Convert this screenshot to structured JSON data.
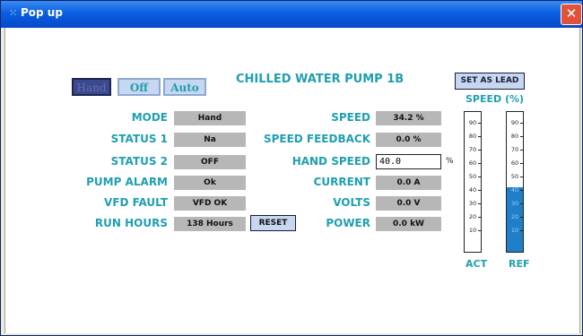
{
  "window": {
    "title": "Pop up"
  },
  "mode_buttons": {
    "hand": "Hand",
    "off": "Off",
    "auto": "Auto"
  },
  "pump_title": "CHILLED WATER PUMP 1B",
  "set_as_lead": "SET AS LEAD",
  "speed_pct_label": "SPEED (%)",
  "left_rows": [
    {
      "label": "MODE",
      "value": "Hand"
    },
    {
      "label": "STATUS 1",
      "value": "Na"
    },
    {
      "label": "STATUS 2",
      "value": "OFF"
    },
    {
      "label": "PUMP ALARM",
      "value": "Ok"
    },
    {
      "label": "VFD FAULT",
      "value": "VFD OK"
    },
    {
      "label": "RUN HOURS",
      "value": "138 Hours"
    }
  ],
  "reset_label": "RESET",
  "right_rows": [
    {
      "label": "SPEED",
      "value": "34.2 %"
    },
    {
      "label": "SPEED FEEDBACK",
      "value": "0.0 %"
    },
    {
      "label": "HAND SPEED",
      "value": "40.0",
      "unit": "%"
    },
    {
      "label": "CURRENT",
      "value": "0.0 A"
    },
    {
      "label": "VOLTS",
      "value": "0.0 V"
    },
    {
      "label": "POWER",
      "value": "0.0 kW"
    }
  ],
  "gauges": {
    "ticks": [
      "90",
      "80",
      "70",
      "60",
      "50",
      "40",
      "30",
      "20",
      "10"
    ],
    "act": {
      "label": "ACT",
      "level_pct": 0
    },
    "ref": {
      "label": "REF",
      "level_pct": 35
    }
  },
  "colors": {
    "accent": "#1f9fb0",
    "titlebar": "#0a5fe0",
    "gauge_fill": "#1f7fc8",
    "value_bg": "#b7b7b7"
  }
}
